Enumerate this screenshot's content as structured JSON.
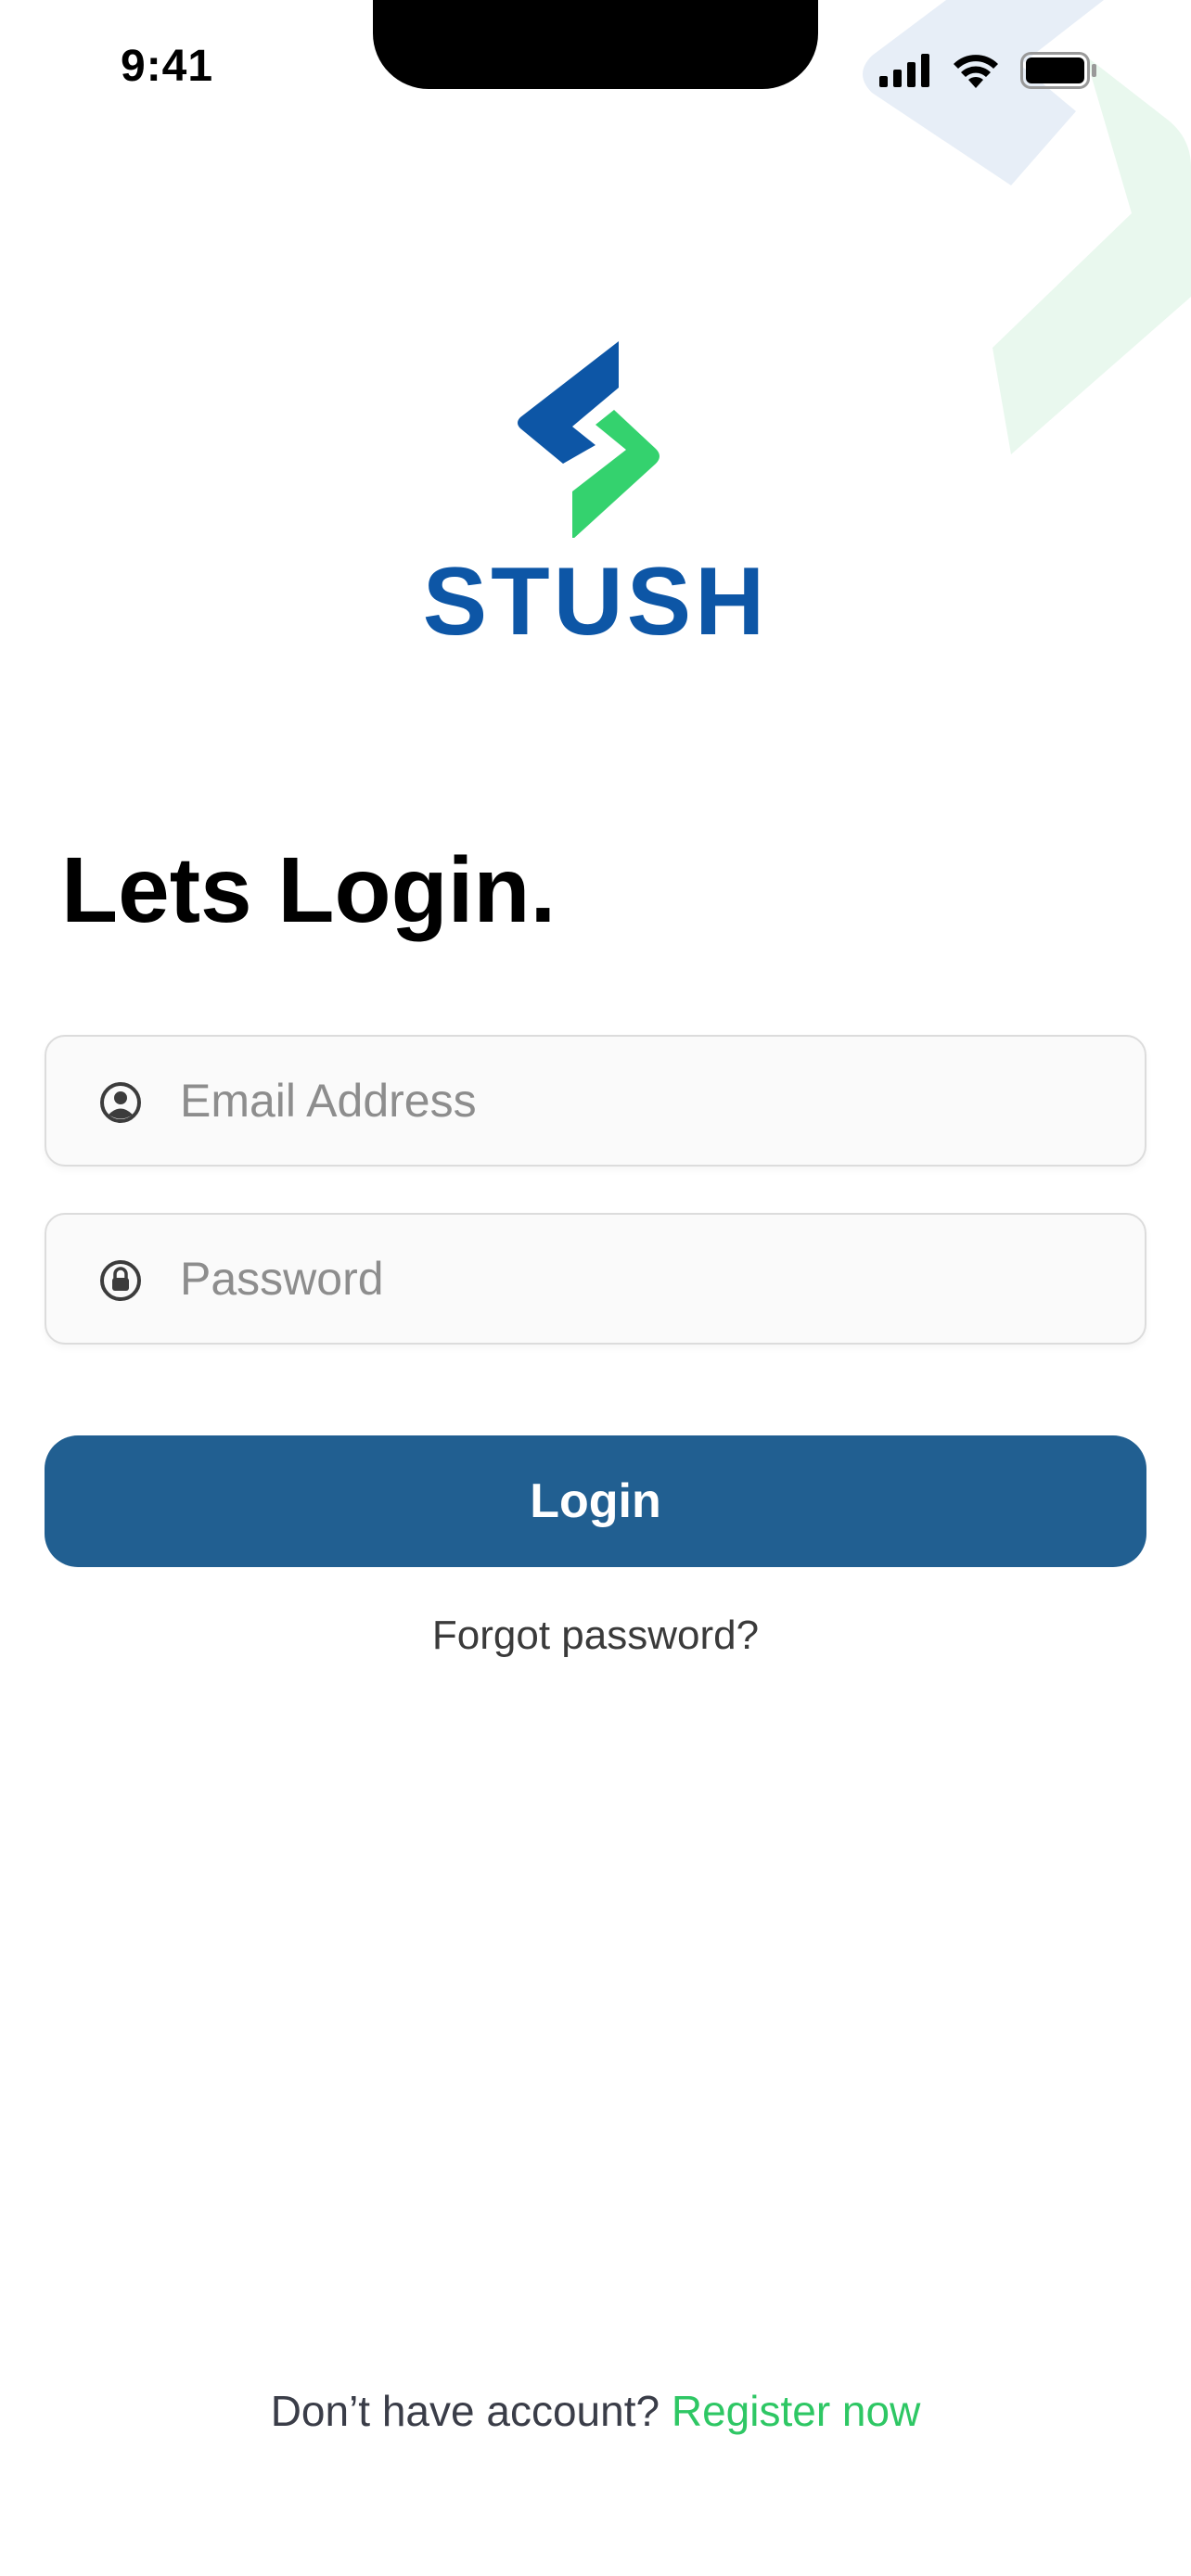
{
  "status_bar": {
    "time": "9:41"
  },
  "brand": {
    "name": "STUSH",
    "primary_color": "#0d56a6",
    "accent_color": "#34d26e"
  },
  "login": {
    "title": "Lets Login.",
    "email_placeholder": "Email Address",
    "email_icon": "user-circle-icon",
    "password_placeholder": "Password",
    "password_icon": "lock-icon",
    "button_label": "Login",
    "button_color": "#215f91",
    "forgot_label": "Forgot password?"
  },
  "footer": {
    "prompt": "Don’t have account? ",
    "register_label": "Register now",
    "register_color": "#2ec764"
  }
}
